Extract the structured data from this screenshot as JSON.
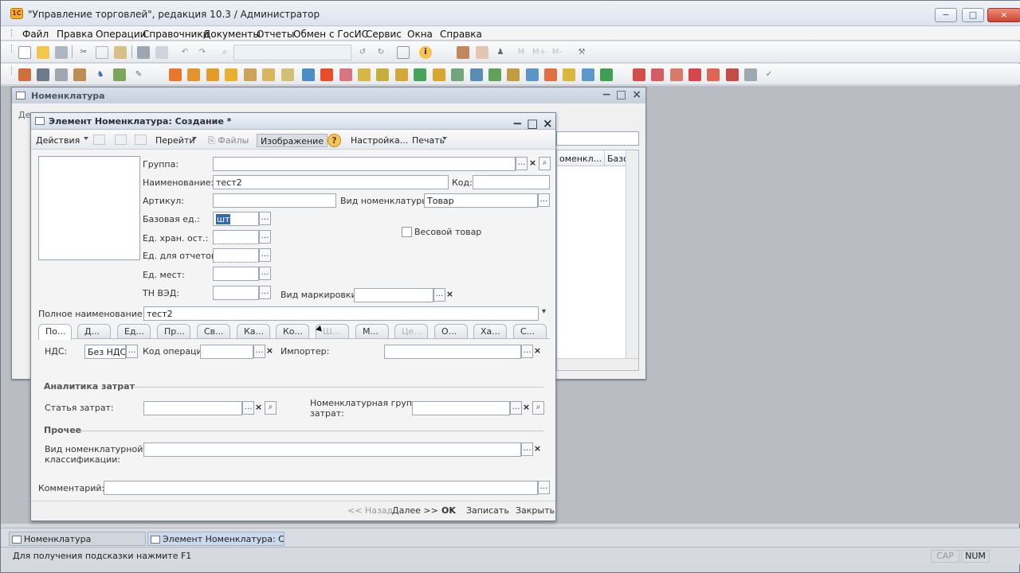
{
  "app": {
    "title": "\"Управление торговлей\", редакция 10.3 / Администратор",
    "logo": "1С"
  },
  "menu": [
    "Файл",
    "Правка",
    "Операции",
    "Справочники",
    "Документы",
    "Отчеты",
    "Обмен с ГосИС",
    "Сервис",
    "Окна",
    "Справка"
  ],
  "toolbar": {
    "search_placeholder": "",
    "icons": [
      "new-icon",
      "open-icon",
      "save-icon",
      "cut-icon",
      "copy-icon",
      "paste-icon",
      "print-icon",
      "preview-icon",
      "undo-icon",
      "redo-icon",
      "find-icon",
      "back-icon",
      "forward-icon",
      "info-icon",
      "calendar-icon",
      "calculator-icon",
      "user-icon",
      "memory-icon",
      "tools-icon"
    ],
    "memory_labels": [
      "M",
      "M+",
      "M-"
    ]
  },
  "background_window": {
    "title": "Номенклатура",
    "grid_headers": [
      "оменкл...",
      "Базо"
    ]
  },
  "dialog": {
    "title": "Элемент Номенклатура: Создание *",
    "toolbar": {
      "actions": "Действия",
      "goto": "Перейти",
      "files": "Файлы",
      "image": "Изображение",
      "settings": "Настройка...",
      "print": "Печать"
    },
    "fields": {
      "group_label": "Группа:",
      "name_label": "Наименование:",
      "name_value": "тест2",
      "code_label": "Код:",
      "article_label": "Артикул:",
      "item_type_label": "Вид номенклатуры:",
      "item_type_value": "Товар",
      "base_unit_label": "Базовая ед.:",
      "base_unit_value": "шт",
      "storage_unit_label": "Ед. хран. ост.:",
      "report_unit_label": "Ед. для отчетов:",
      "place_unit_label": "Ед. мест:",
      "tn_ved_label": "ТН ВЭД:",
      "weight_label": "Весовой товар",
      "marking_label": "Вид маркировки:",
      "full_name_label": "Полное наименование:",
      "full_name_value": "тест2"
    },
    "tabs": [
      "По...",
      "Д...",
      "Ед...",
      "Пр...",
      "Св...",
      "Ка...",
      "Ко...",
      "Ш...",
      "М...",
      "Це...",
      "О...",
      "Ха...",
      "С..."
    ],
    "panel": {
      "vat_label": "НДС:",
      "vat_value": "Без НДС",
      "operation_code_label": "Код операции:",
      "importer_label": "Импортер:",
      "cost_analytics": "Аналитика затрат",
      "cost_item_label": "Статья затрат:",
      "cost_group_label_1": "Номенклатурная группа",
      "cost_group_label_2": "затрат:",
      "other": "Прочее",
      "classification_label_1": "Вид номенклатурной",
      "classification_label_2": "классификации:"
    },
    "comment_label": "Комментарий:",
    "footer": {
      "back": "<< Назад",
      "next": "Далее >>",
      "ok": "OK",
      "write": "Записать",
      "close": "Закрыть"
    }
  },
  "taskbar": [
    "Номенклатура",
    "Элемент Номенклатура: Со..."
  ],
  "status": {
    "hint": "Для получения подсказки нажмите F1",
    "cap": "CAP",
    "num": "NUM"
  },
  "colors": {
    "accent": "#3568b1",
    "titlebar": "#dce3ed",
    "close": "#c94431"
  }
}
